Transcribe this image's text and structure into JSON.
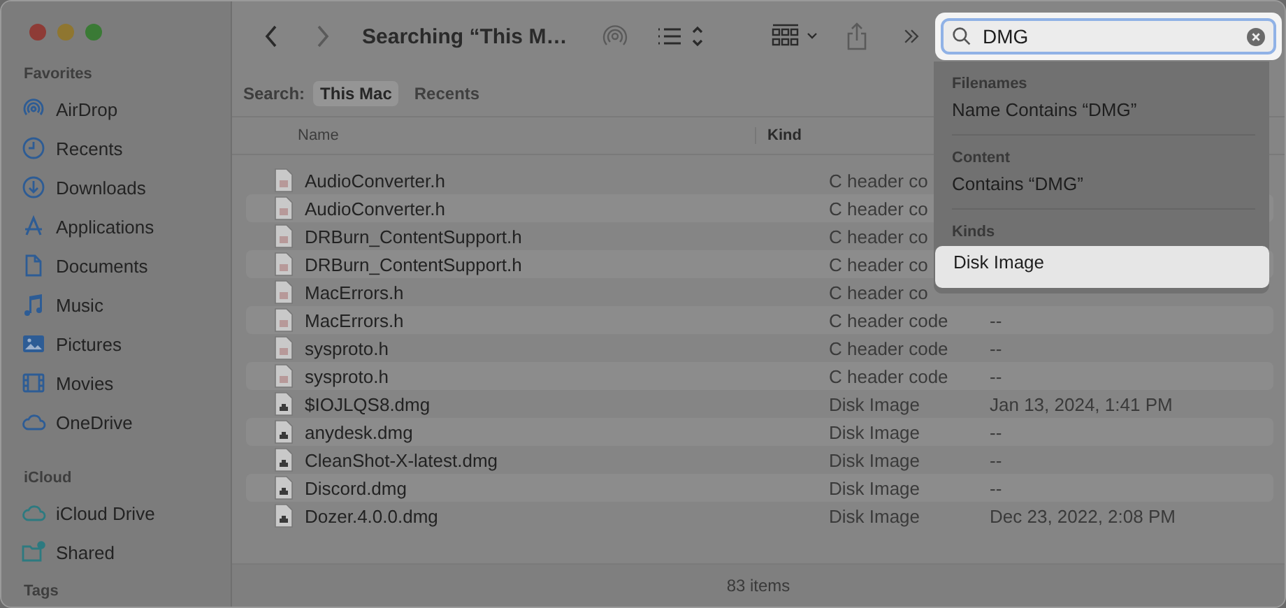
{
  "window": {
    "title": "Searching “This M…"
  },
  "sidebar": [
    {
      "heading": "Favorites",
      "items": [
        {
          "label": "AirDrop",
          "kind": "airdrop"
        },
        {
          "label": "Recents",
          "kind": "clock"
        },
        {
          "label": "Downloads",
          "kind": "download"
        },
        {
          "label": "Applications",
          "kind": "apps"
        },
        {
          "label": "Documents",
          "kind": "document"
        },
        {
          "label": "Music",
          "kind": "music"
        },
        {
          "label": "Pictures",
          "kind": "picture"
        },
        {
          "label": "Movies",
          "kind": "film"
        },
        {
          "label": "OneDrive",
          "kind": "cloud"
        }
      ]
    },
    {
      "heading": "iCloud",
      "items": [
        {
          "label": "iCloud Drive",
          "kind": "icloud"
        },
        {
          "label": "Shared",
          "kind": "shared"
        }
      ]
    },
    {
      "heading": "Tags"
    }
  ],
  "search": {
    "value": "DMG"
  },
  "scope": {
    "label": "Search:",
    "options": [
      {
        "label": "This Mac",
        "selected": true
      },
      {
        "label": "Recents",
        "selected": false
      }
    ]
  },
  "columns": [
    "Name",
    "Kind"
  ],
  "files": [
    {
      "name": "AudioConverter.h",
      "kind_label": "C header co",
      "kind": "header"
    },
    {
      "name": "AudioConverter.h",
      "kind_label": "C header co",
      "kind": "header"
    },
    {
      "name": "DRBurn_ContentSupport.h",
      "kind_label": "C header co",
      "kind": "header"
    },
    {
      "name": "DRBurn_ContentSupport.h",
      "kind_label": "C header co",
      "kind": "header"
    },
    {
      "name": "MacErrors.h",
      "kind_label": "C header co",
      "kind": "header"
    },
    {
      "name": "MacErrors.h",
      "kind_label": "C header code",
      "date": "--",
      "kind": "header"
    },
    {
      "name": "sysproto.h",
      "kind_label": "C header code",
      "date": "--",
      "kind": "header"
    },
    {
      "name": "sysproto.h",
      "kind_label": "C header code",
      "date": "--",
      "kind": "header"
    },
    {
      "name": "$IOJLQS8.dmg",
      "kind_label": "Disk Image",
      "date": "Jan 13, 2024, 1:41 PM",
      "kind": "disk"
    },
    {
      "name": "anydesk.dmg",
      "kind_label": "Disk Image",
      "date": "--",
      "kind": "disk"
    },
    {
      "name": "CleanShot-X-latest.dmg",
      "kind_label": "Disk Image",
      "date": "--",
      "kind": "disk"
    },
    {
      "name": "Discord.dmg",
      "kind_label": "Disk Image",
      "date": "--",
      "kind": "disk"
    },
    {
      "name": "Dozer.4.0.0.dmg",
      "kind_label": "Disk Image",
      "date": "Dec 23, 2022, 2:08 PM",
      "kind": "disk"
    }
  ],
  "suggestions": [
    {
      "heading": "Filenames",
      "items": [
        {
          "label": "Name Contains “DMG”",
          "selected": false
        }
      ]
    },
    {
      "heading": "Content",
      "items": [
        {
          "label": "Contains “DMG”",
          "selected": false
        }
      ]
    },
    {
      "heading": "Kinds",
      "items": [
        {
          "label": "Disk Image",
          "selected": true
        }
      ]
    }
  ],
  "status_bar": "83 items"
}
